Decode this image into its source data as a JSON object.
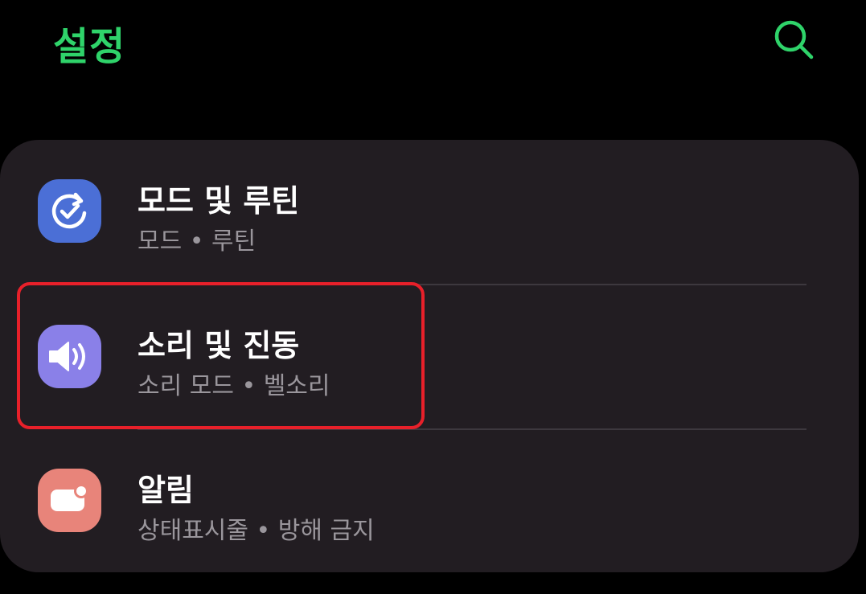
{
  "header": {
    "title": "설정",
    "search_icon": "search-icon",
    "accent_color": "#2fd36a"
  },
  "settings": {
    "items": [
      {
        "title": "모드 및 루틴",
        "subtitle": "모드 • 루틴",
        "icon": "check-cycle-icon",
        "icon_color": "#4b6fd6"
      },
      {
        "title": "소리 및 진동",
        "subtitle": "소리 모드 • 벨소리",
        "icon": "speaker-icon",
        "icon_color": "#8a80e8"
      },
      {
        "title": "알림",
        "subtitle": "상태표시줄 • 방해 금지",
        "icon": "notification-icon",
        "icon_color": "#e8847a"
      }
    ]
  },
  "highlight_color": "#e8202a"
}
